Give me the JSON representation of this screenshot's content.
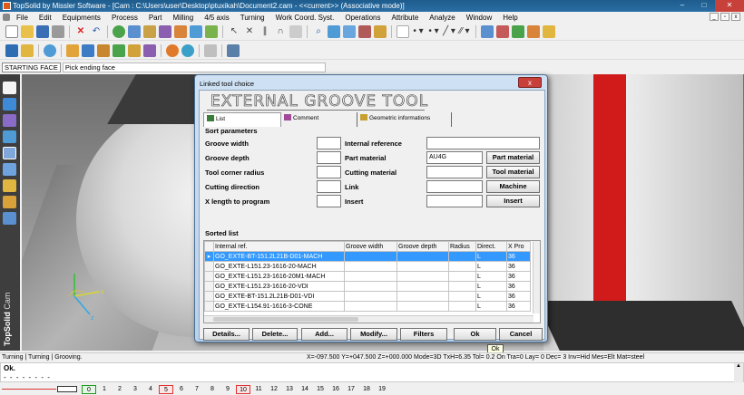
{
  "app": {
    "title": "TopSolid by Missler Software - [Cam : C:\\Users\\user\\Desktop\\ptuxikah\\Document2.cam - <<current>> (Associative mode)]",
    "win_minimize": "–",
    "win_maximize": "□",
    "win_close": "✕"
  },
  "menu": [
    "File",
    "Edit",
    "Equipments",
    "Process",
    "Part",
    "Milling",
    "4/5 axis",
    "Turning",
    "Work Coord. Syst.",
    "Operations",
    "Attribute",
    "Analyze",
    "Window",
    "Help"
  ],
  "mdi": {
    "min": "_",
    "restore": "▫",
    "close": "x"
  },
  "prompt": {
    "mode": "STARTING FACE",
    "text": "Pick ending face"
  },
  "brand": {
    "name": "TopSolid",
    "module": "Cam"
  },
  "status": {
    "left": "Turning | Turning | Grooving.",
    "right": "X=-097.500   Y=+047.500  Z=+000.000  Mode=3D  TxH=6.35   Tol=  0.2    On  Tra=0    Lay=  0    Dec=  3    Inv=Hid  Mes=Elt  Mat=steel"
  },
  "console": {
    "line1": "Ok.",
    "line2": "- - - - - - - -"
  },
  "layers": [
    "0",
    "1",
    "2",
    "3",
    "4",
    "5",
    "6",
    "7",
    "8",
    "9",
    "10",
    "11",
    "12",
    "13",
    "14",
    "15",
    "16",
    "17",
    "18",
    "19"
  ],
  "dialog": {
    "title": "Linked tool choice",
    "close_label": "x",
    "heading": "EXTERNAL GROOVE TOOL",
    "tabs": [
      {
        "label": "List"
      },
      {
        "label": "Comment"
      },
      {
        "label": "Geometric informations"
      }
    ],
    "sort_parameters_label": "Sort parameters",
    "left_fields": [
      {
        "label": "Groove width",
        "value": ""
      },
      {
        "label": "Groove depth",
        "value": ""
      },
      {
        "label": "Tool corner radius",
        "value": ""
      },
      {
        "label": "Cutting direction",
        "value": ""
      },
      {
        "label": "X length to program",
        "value": ""
      }
    ],
    "right_fields": [
      {
        "label": "Internal reference",
        "value": ""
      },
      {
        "label": "Part material",
        "value": "AU4G"
      },
      {
        "label": "Cutting material",
        "value": ""
      },
      {
        "label": "Link",
        "value": ""
      },
      {
        "label": "Insert",
        "value": ""
      }
    ],
    "side_buttons": [
      "Part material",
      "Tool material",
      "Machine",
      "Insert"
    ],
    "sorted_list_label": "Sorted list",
    "columns": [
      "Internal ref.",
      "Groove width",
      "Groove depth",
      "Radius",
      "Direct.",
      "X Pro"
    ],
    "rows": [
      {
        "marker": "▸",
        "ref": "GO_EXTE-BT-151.2L21B-D01-MACH",
        "width": "",
        "depth": "",
        "radius": "",
        "direct": "L",
        "xpro": "36"
      },
      {
        "marker": "",
        "ref": "GO_EXTE-L151.23-1616-20-MACH",
        "width": "",
        "depth": "",
        "radius": "",
        "direct": "L",
        "xpro": "36"
      },
      {
        "marker": "",
        "ref": "GO_EXTE-L151.23-1616-20M1-MACH",
        "width": "",
        "depth": "",
        "radius": "",
        "direct": "L",
        "xpro": "36"
      },
      {
        "marker": "",
        "ref": "GO_EXTE-L151.23-1616-20-VDI",
        "width": "",
        "depth": "",
        "radius": "",
        "direct": "L",
        "xpro": "36"
      },
      {
        "marker": "",
        "ref": "GO_EXTE-BT-151.2L21B-D01-VDI",
        "width": "",
        "depth": "",
        "radius": "",
        "direct": "L",
        "xpro": "36"
      },
      {
        "marker": "",
        "ref": "GO_EXTE-L154.91-1616-3-CONE",
        "width": "",
        "depth": "",
        "radius": "",
        "direct": "L",
        "xpro": "36"
      }
    ],
    "bottom_buttons": [
      "Details...",
      "Delete...",
      "Add...",
      "Modify...",
      "Filters",
      "Ok",
      "Cancel"
    ],
    "tooltip": "Ok"
  }
}
